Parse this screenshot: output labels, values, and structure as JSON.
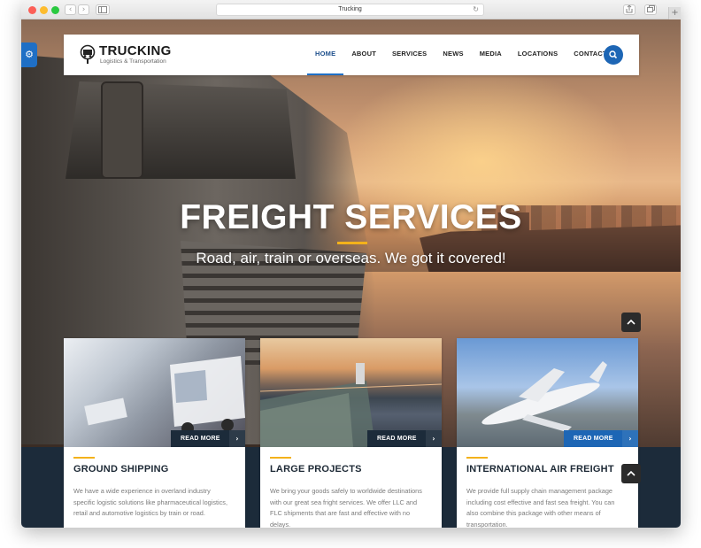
{
  "browser": {
    "url_title": "Trucking",
    "back": "‹",
    "forward": "›",
    "reload": "↻",
    "new_tab": "+"
  },
  "site": {
    "brand": "TRUCKING",
    "tagline": "Logistics & Transportation",
    "accent": "#1f6fc5",
    "highlight": "#f3b21b",
    "dark": "#1c2b3a"
  },
  "menu": [
    {
      "label": "HOME",
      "active": true
    },
    {
      "label": "ABOUT"
    },
    {
      "label": "SERVICES"
    },
    {
      "label": "NEWS"
    },
    {
      "label": "MEDIA"
    },
    {
      "label": "LOCATIONS"
    },
    {
      "label": "CONTACT"
    }
  ],
  "hero": {
    "title": "FREIGHT SERVICES",
    "subtitle": "Road, air, train or overseas. We got it covered!"
  },
  "cards": [
    {
      "title": "GROUND SHIPPING",
      "read_more": "READ MORE",
      "text": "We have a wide experience in overland industry specific logistic solutions like pharmaceutical logistics, retail and automotive logistics by train or road."
    },
    {
      "title": "LARGE PROJECTS",
      "read_more": "READ MORE",
      "text": "We bring your goods safely to worldwide destinations with our great sea fright services. We offer LLC and FLC shipments that are fast and effective with no delays."
    },
    {
      "title": "INTERNATIONAL AIR FREIGHT",
      "read_more": "READ MORE",
      "text": "We provide full supply chain management package including cost effective and fast sea freight. You can also combine this package with other means of transportation."
    }
  ]
}
